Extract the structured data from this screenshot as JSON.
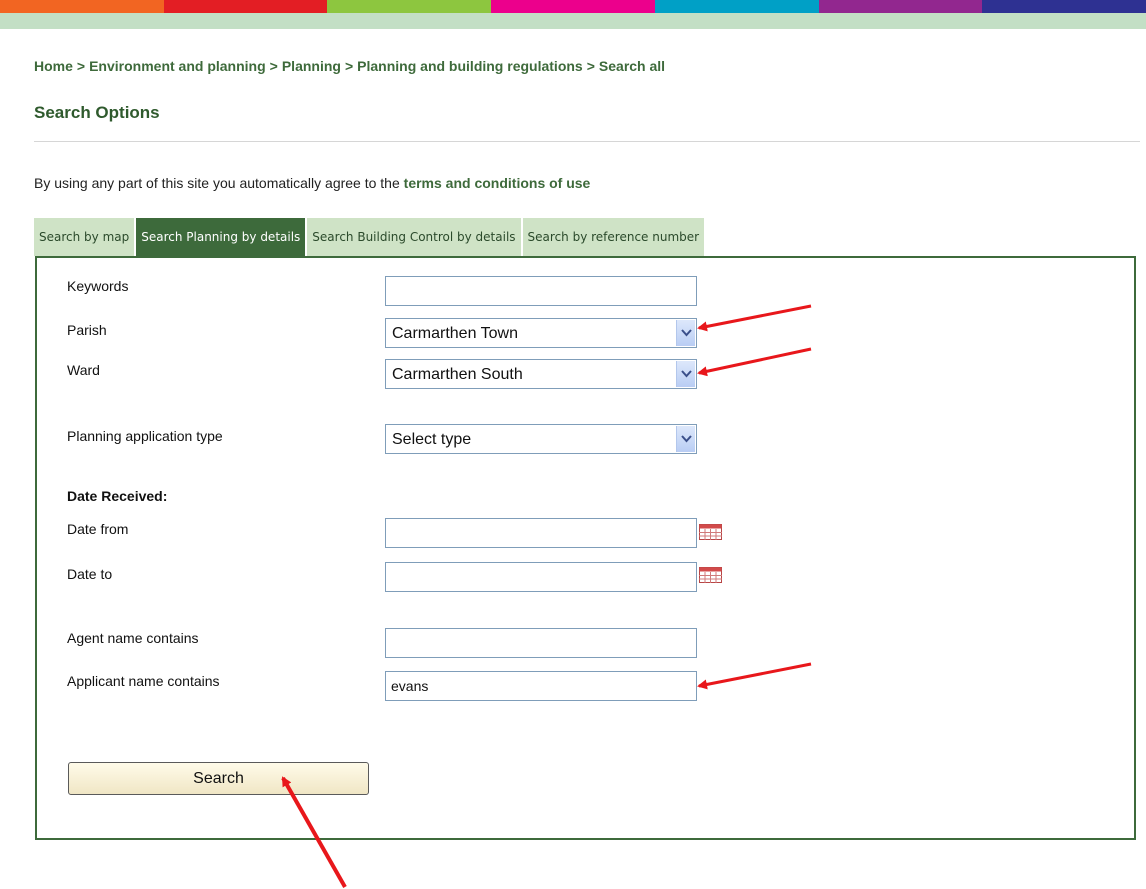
{
  "header": {
    "color_segments": [
      "#f26522",
      "#e31e24",
      "#8dc63f",
      "#ec008c",
      "#00a0c6",
      "#92278f",
      "#2e3192"
    ],
    "strip_color": "#c3dfc5"
  },
  "breadcrumb": {
    "items": [
      "Home",
      "Environment and planning",
      "Planning",
      "Planning and building regulations",
      "Search all"
    ],
    "separator": ">"
  },
  "page": {
    "title": "Search Options",
    "terms_prefix": "By using any part of this site you automatically agree to the",
    "terms_link": "terms and conditions of use"
  },
  "tabs": [
    {
      "label": "Search by map",
      "active": false
    },
    {
      "label": "Search Planning by details",
      "active": true
    },
    {
      "label": "Search Building Control by details",
      "active": false
    },
    {
      "label": "Search by reference number",
      "active": false
    }
  ],
  "form": {
    "keywords": {
      "label": "Keywords",
      "value": ""
    },
    "parish": {
      "label": "Parish",
      "selected": "Carmarthen Town"
    },
    "ward": {
      "label": "Ward",
      "selected": "Carmarthen South"
    },
    "app_type": {
      "label": "Planning application type",
      "selected": "Select type"
    },
    "date_received_heading": "Date Received:",
    "date_from": {
      "label": "Date from",
      "value": ""
    },
    "date_to": {
      "label": "Date to",
      "value": ""
    },
    "agent": {
      "label": "Agent name contains",
      "value": ""
    },
    "applicant": {
      "label": "Applicant name contains",
      "value": "evans"
    },
    "search_button": "Search"
  },
  "icons": {
    "dropdown": "chevron-down-icon",
    "calendar": "calendar-icon",
    "annotation": "red-arrow"
  },
  "colors": {
    "accent_green": "#3d6a3b",
    "tab_inactive": "#cfe3c6",
    "annotation_red": "#e8171b"
  }
}
